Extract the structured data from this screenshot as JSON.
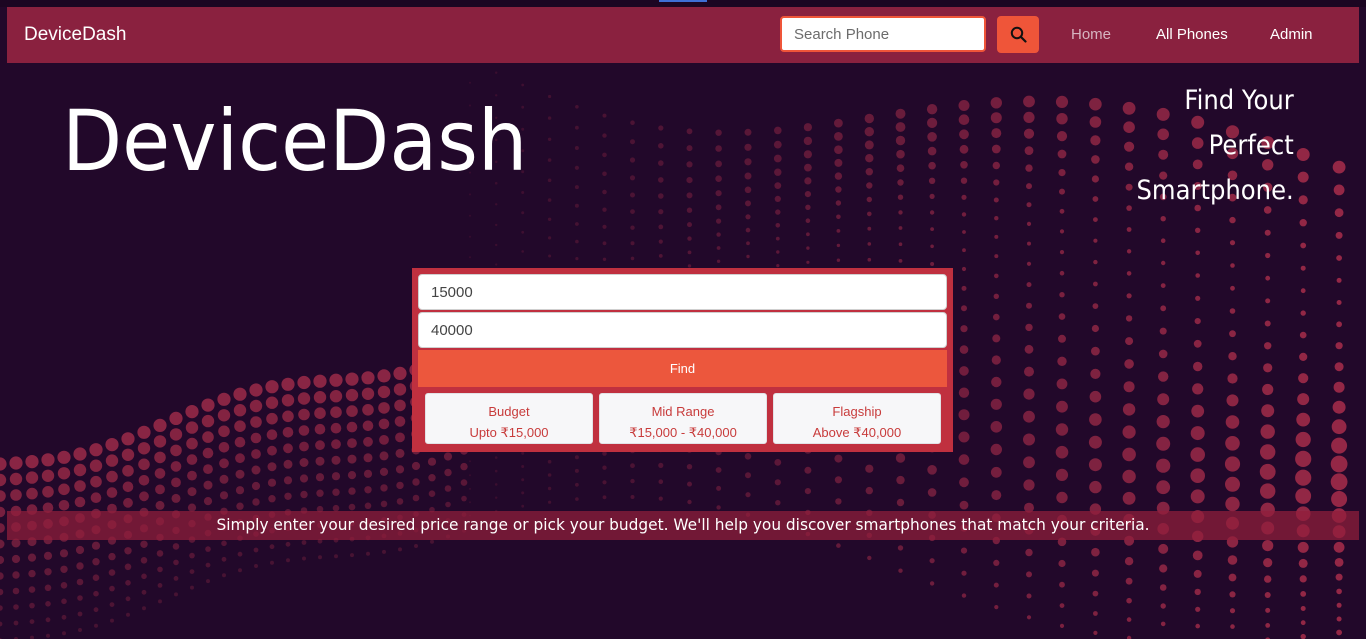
{
  "navbar": {
    "brand": "DeviceDash",
    "search_placeholder": "Search Phone",
    "links": [
      "Home",
      "All Phones",
      "Admin"
    ]
  },
  "hero": {
    "title": "DeviceDash",
    "tagline": [
      "Find Your",
      "Perfect",
      "Smartphone."
    ]
  },
  "finder": {
    "min_price": "15000",
    "max_price": "40000",
    "find_label": "Find",
    "ranges": [
      {
        "name": "Budget",
        "range": "Upto ₹15,000"
      },
      {
        "name": "Mid Range",
        "range": "₹15,000 - ₹40,000"
      },
      {
        "name": "Flagship",
        "range": "Above ₹40,000"
      }
    ]
  },
  "banner": {
    "text": "Simply enter your desired price range or pick your budget. We'll help you discover smartphones that match your criteria."
  },
  "colors": {
    "navbar": "#8a213f",
    "accent": "#ef5539",
    "background": "#22082a",
    "dots": "#b8324f"
  },
  "icons": {
    "search": "search-icon"
  }
}
